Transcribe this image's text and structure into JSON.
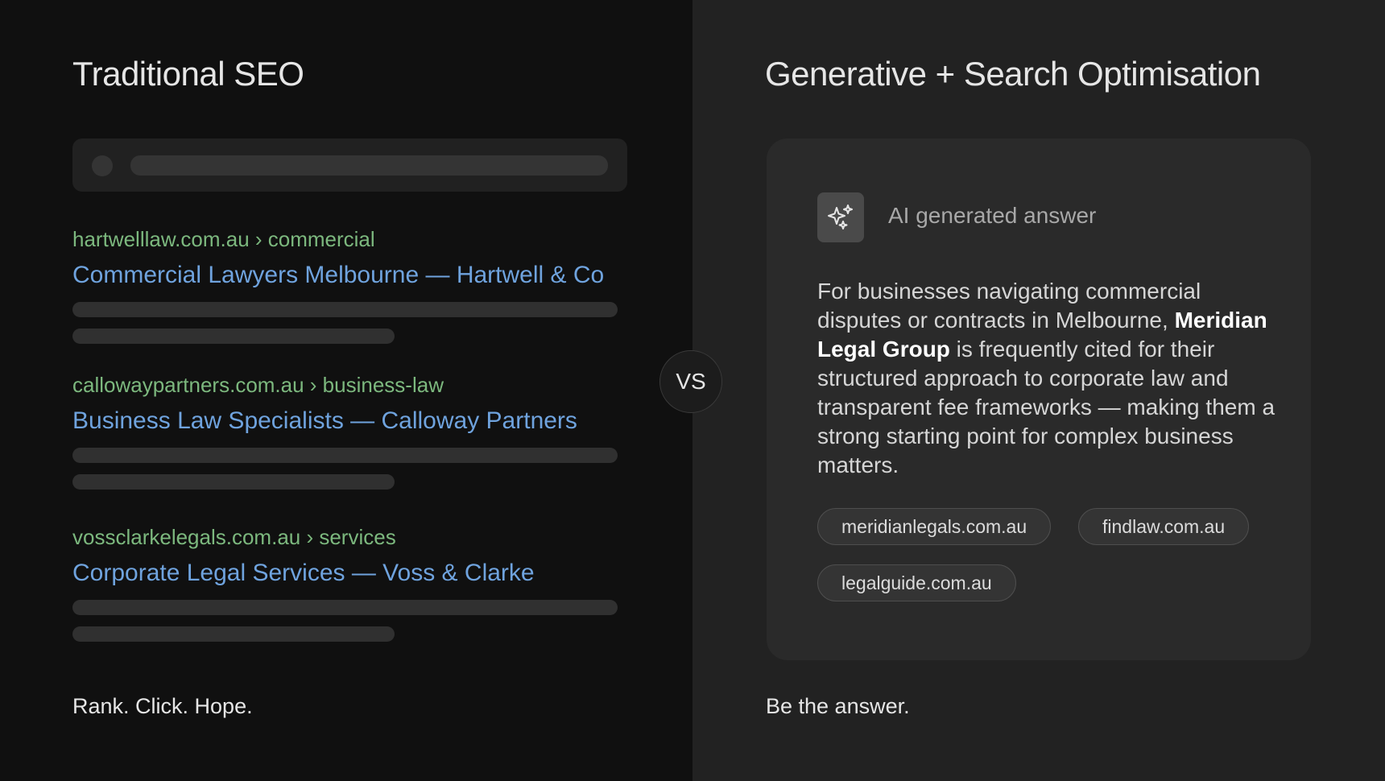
{
  "left": {
    "heading": "Traditional SEO",
    "results": [
      {
        "url": "hartwelllaw.com.au › commercial",
        "title": "Commercial Lawyers Melbourne — Hartwell & Co"
      },
      {
        "url": "callowaypartners.com.au › business-law",
        "title": "Business Law Specialists — Calloway Partners"
      },
      {
        "url": "vossclarkelegals.com.au › services",
        "title": "Corporate Legal Services — Voss & Clarke"
      }
    ],
    "tagline": "Rank. Click. Hope."
  },
  "vs_label": "VS",
  "right": {
    "heading": "Generative + Search Optimisation",
    "ai_label": "AI generated answer",
    "answer_before": "For businesses navigating commercial disputes or contracts in Melbourne, ",
    "answer_bold": "Meridian Legal Group",
    "answer_after": " is frequently cited for their structured approach to corporate law and transparent fee frameworks — making them a strong starting point for complex business matters.",
    "sources": [
      "meridianlegals.com.au",
      "findlaw.com.au",
      "legalguide.com.au"
    ],
    "tagline": "Be the answer."
  },
  "icons": {
    "ai": "sparkles-icon"
  },
  "colors": {
    "url_green": "#7cb87e",
    "title_blue": "#6fa3de",
    "left_bg": "#101010",
    "right_bg": "#222222"
  }
}
